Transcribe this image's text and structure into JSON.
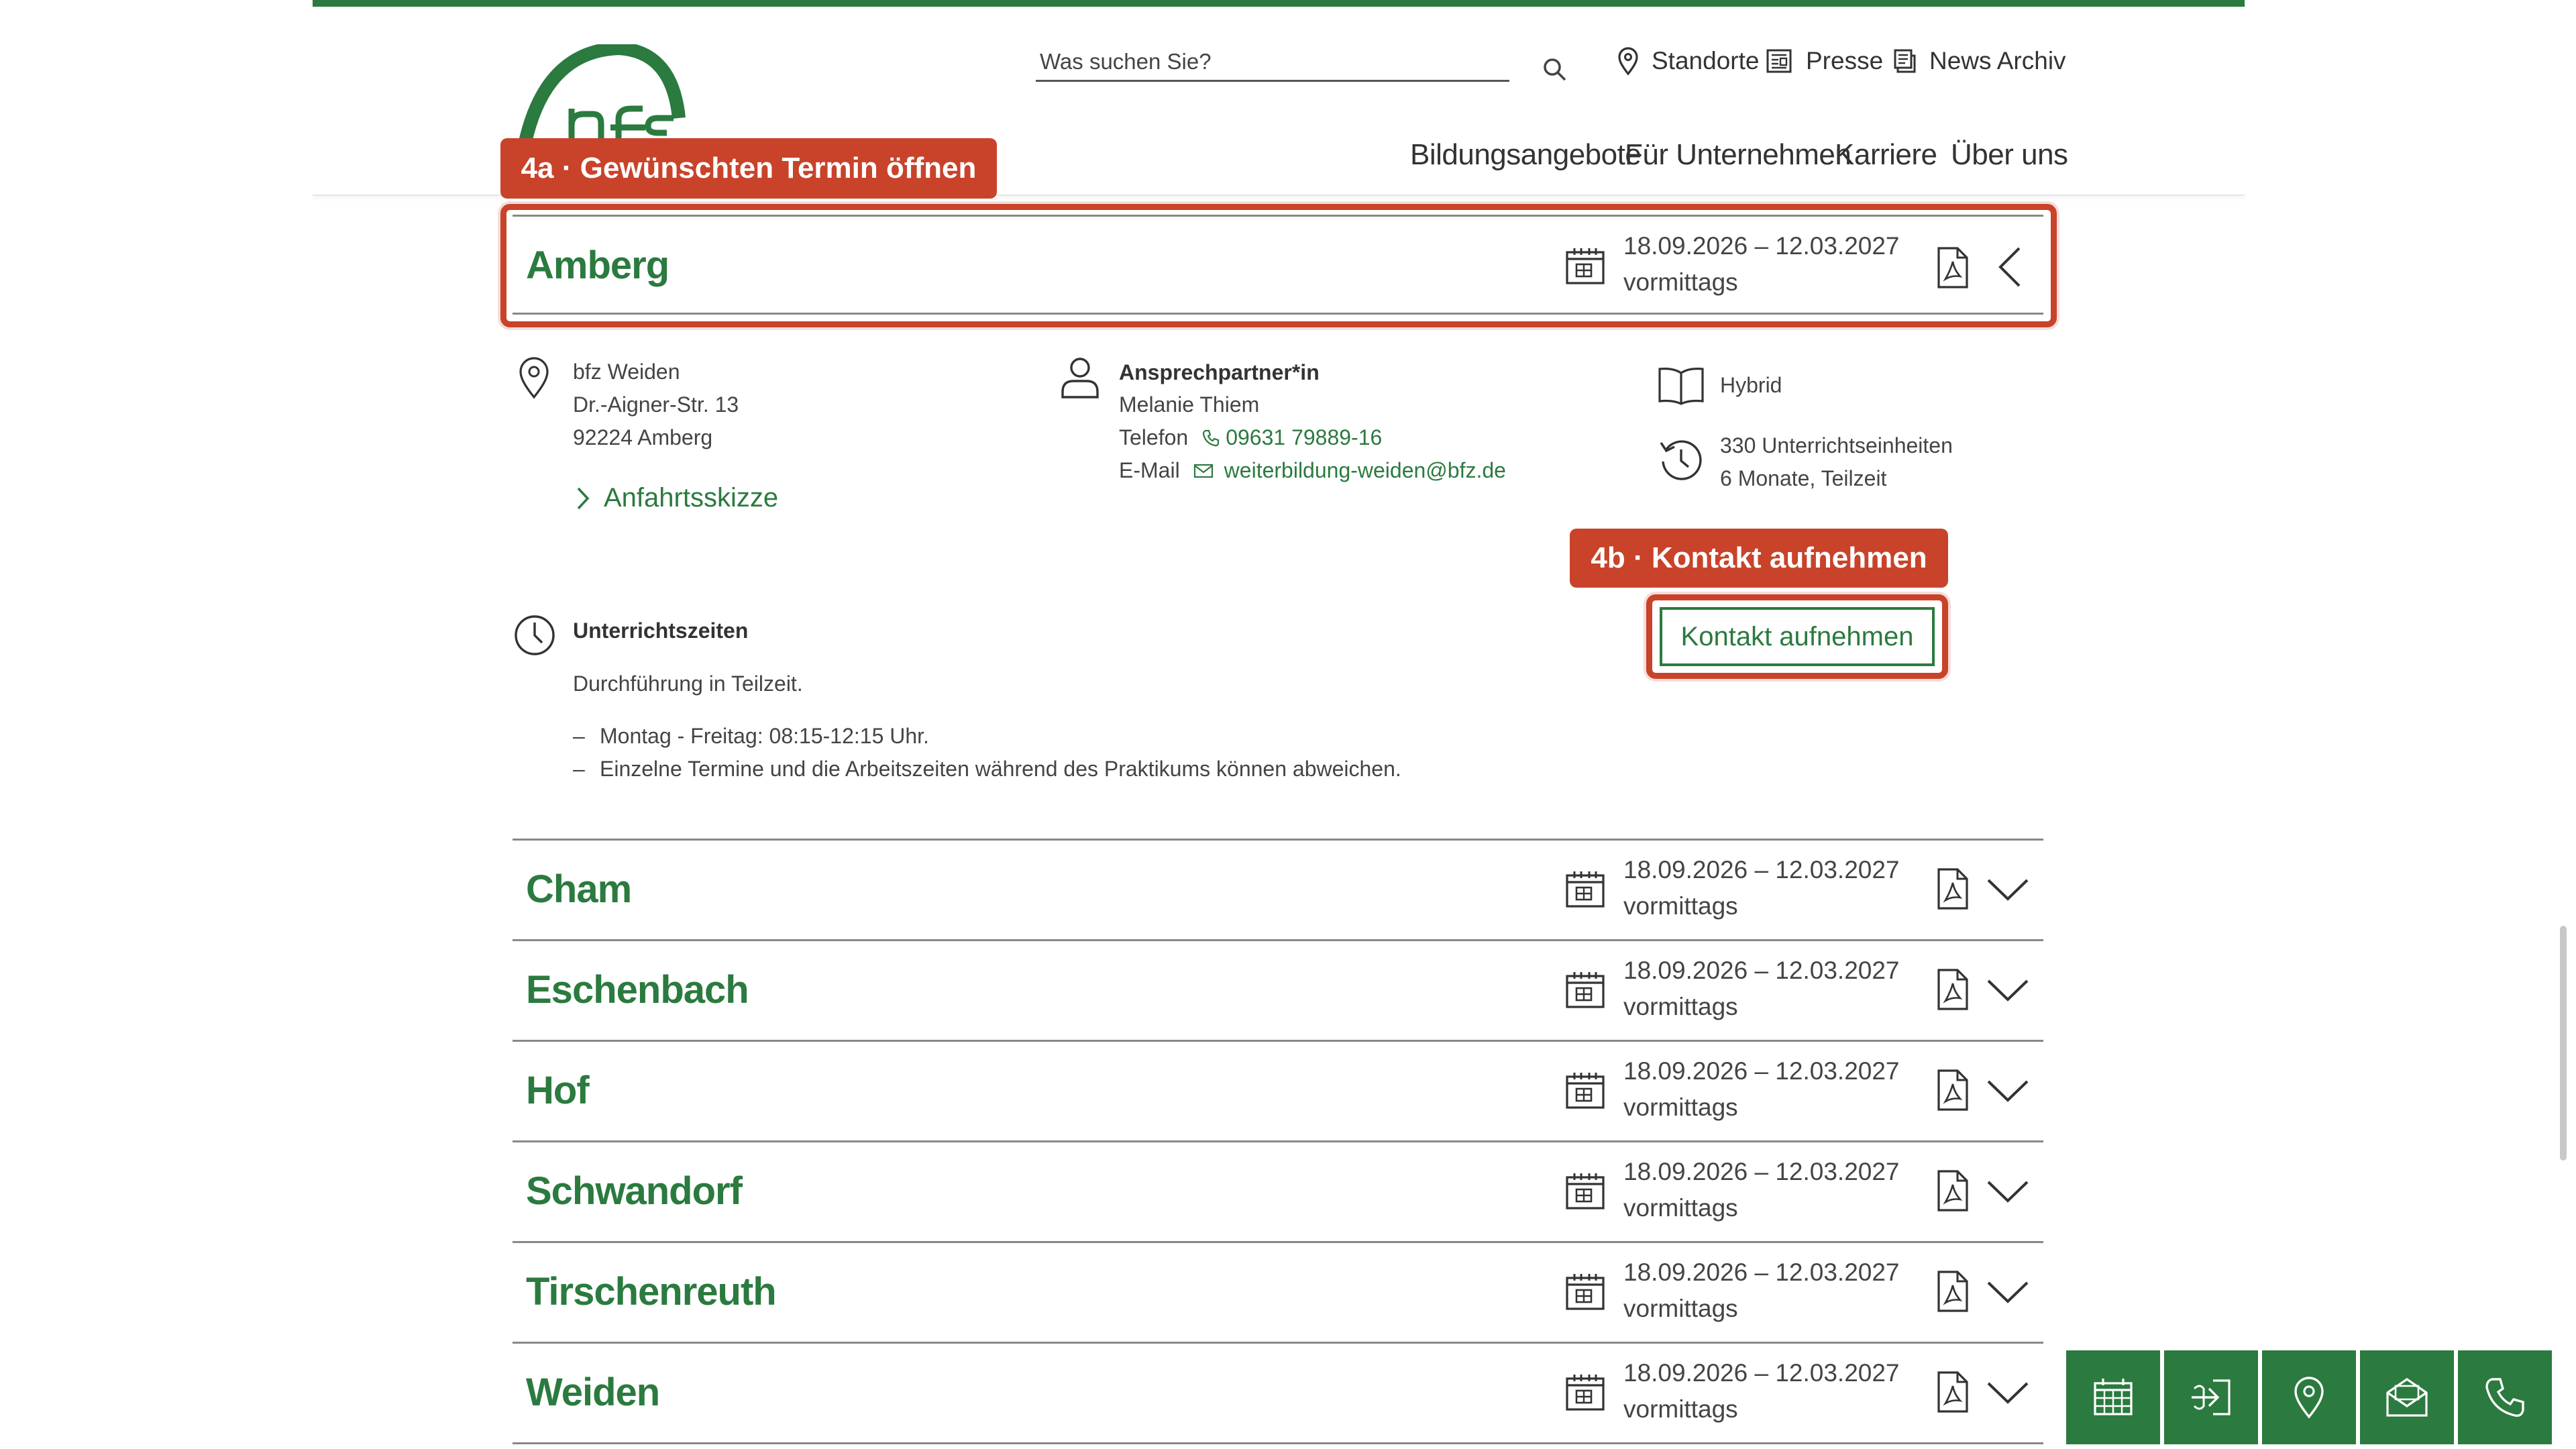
{
  "header": {
    "search": {
      "placeholder": "Was suchen Sie?",
      "icon": "search-icon"
    },
    "utility_nav": [
      {
        "label": "Standorte",
        "icon": "location-pin-icon"
      },
      {
        "label": "Presse",
        "icon": "newspaper-icon"
      },
      {
        "label": "News Archiv",
        "icon": "news-archive-icon"
      }
    ],
    "main_nav": [
      "Bildungsangebote",
      "Für Unternehmen",
      "Karriere",
      "Über uns"
    ],
    "logo_text": "bfz"
  },
  "annotations": {
    "step_4a": "4a · Gewünschten Termin öffnen",
    "step_4b": "4b · Kontakt aufnehmen"
  },
  "expanded": {
    "location": "Amberg",
    "date_range": "18.09.2026 – 12.03.2027",
    "time_of_day": "vormittags",
    "address": {
      "name": "bfz Weiden",
      "street": "Dr.-Aigner-Str. 13",
      "city": "92224 Amberg"
    },
    "directions_link": "Anfahrtsskizze",
    "contact": {
      "heading": "Ansprechpartner*in",
      "name": "Melanie Thiem",
      "phone_label": "Telefon",
      "phone": "09631 79889-16",
      "email_label": "E-Mail",
      "email": "weiterbildung-weiden@bfz.de"
    },
    "format": "Hybrid",
    "duration_units": "330 Unterrichtseinheiten",
    "duration_time": "6 Monate, Teilzeit",
    "contact_button": "Kontakt aufnehmen",
    "schedule": {
      "heading": "Unterrichtszeiten",
      "intro": "Durchführung in Teilzeit.",
      "items": [
        "Montag - Freitag: 08:15-12:15 Uhr.",
        "Einzelne Termine und die Arbeitszeiten während des Praktikums können abweichen."
      ]
    }
  },
  "locations": [
    {
      "name": "Cham",
      "date_range": "18.09.2026 – 12.03.2027",
      "time_of_day": "vormittags"
    },
    {
      "name": "Eschenbach",
      "date_range": "18.09.2026 – 12.03.2027",
      "time_of_day": "vormittags"
    },
    {
      "name": "Hof",
      "date_range": "18.09.2026 – 12.03.2027",
      "time_of_day": "vormittags"
    },
    {
      "name": "Schwandorf",
      "date_range": "18.09.2026 – 12.03.2027",
      "time_of_day": "vormittags"
    },
    {
      "name": "Tirschenreuth",
      "date_range": "18.09.2026 – 12.03.2027",
      "time_of_day": "vormittags"
    },
    {
      "name": "Weiden",
      "date_range": "18.09.2026 – 12.03.2027",
      "time_of_day": "vormittags"
    }
  ],
  "quick_actions": [
    "calendar-icon",
    "login-icon",
    "location-pin-icon",
    "mail-icon",
    "phone-icon"
  ],
  "colors": {
    "brand_green": "#2b7a3f",
    "annotation_red": "#c8432a"
  }
}
